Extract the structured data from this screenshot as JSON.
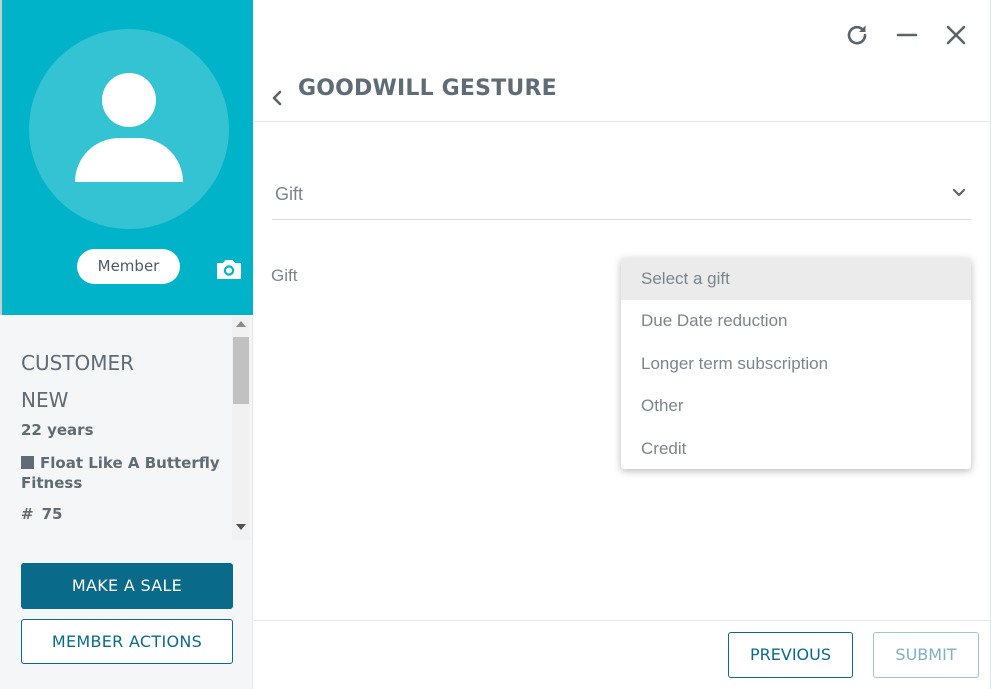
{
  "profile": {
    "badge": "Member",
    "name_line1": "CUSTOMER",
    "name_line2": "NEW",
    "age": "22 years",
    "gym": "Float Like A Butterfly Fitness",
    "number_prefix": "#",
    "number": "75",
    "icons": {
      "avatar": "user-silhouette-icon",
      "camera": "camera-icon",
      "gym": "square-icon"
    }
  },
  "actions": {
    "make_sale": "MAKE A SALE",
    "member_actions": "MEMBER ACTIONS"
  },
  "window": {
    "refresh": "refresh-icon",
    "minimize": "minimize-icon",
    "close": "close-icon"
  },
  "main": {
    "title": "GOODWILL GESTURE",
    "category_select": {
      "value": "Gift"
    },
    "gift_field_label": "Gift",
    "gift_options": [
      "Select a gift",
      "Due Date reduction",
      "Longer term subscription",
      "Other",
      "Credit"
    ],
    "highlighted_option_index": 0
  },
  "footer": {
    "previous": "PREVIOUS",
    "submit": "SUBMIT"
  },
  "colors": {
    "header_teal": "#00b3c8",
    "primary": "#0a6a8a",
    "text": "#5f6b75"
  }
}
